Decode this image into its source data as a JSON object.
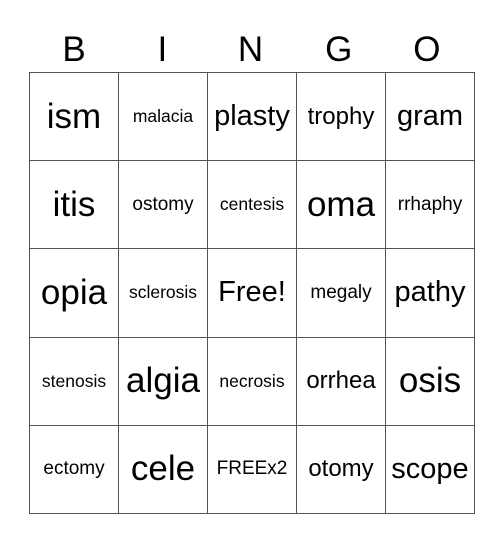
{
  "header": [
    "B",
    "I",
    "N",
    "G",
    "O"
  ],
  "rows": [
    [
      {
        "text": "ism",
        "size": "xl"
      },
      {
        "text": "malacia",
        "size": "xs"
      },
      {
        "text": "plasty",
        "size": "l"
      },
      {
        "text": "trophy",
        "size": "m"
      },
      {
        "text": "gram",
        "size": "l"
      }
    ],
    [
      {
        "text": "itis",
        "size": "xl"
      },
      {
        "text": "ostomy",
        "size": "s"
      },
      {
        "text": "centesis",
        "size": "xs"
      },
      {
        "text": "oma",
        "size": "xl"
      },
      {
        "text": "rrhaphy",
        "size": "s"
      }
    ],
    [
      {
        "text": "opia",
        "size": "xl"
      },
      {
        "text": "sclerosis",
        "size": "xs"
      },
      {
        "text": "Free!",
        "size": "l"
      },
      {
        "text": "megaly",
        "size": "s"
      },
      {
        "text": "pathy",
        "size": "l"
      }
    ],
    [
      {
        "text": "stenosis",
        "size": "xs"
      },
      {
        "text": "algia",
        "size": "xl"
      },
      {
        "text": "necrosis",
        "size": "xs"
      },
      {
        "text": "orrhea",
        "size": "m"
      },
      {
        "text": "osis",
        "size": "xl"
      }
    ],
    [
      {
        "text": "ectomy",
        "size": "s"
      },
      {
        "text": "cele",
        "size": "xl"
      },
      {
        "text": "FREEx2",
        "size": "s"
      },
      {
        "text": "otomy",
        "size": "m"
      },
      {
        "text": "scope",
        "size": "l"
      }
    ]
  ]
}
